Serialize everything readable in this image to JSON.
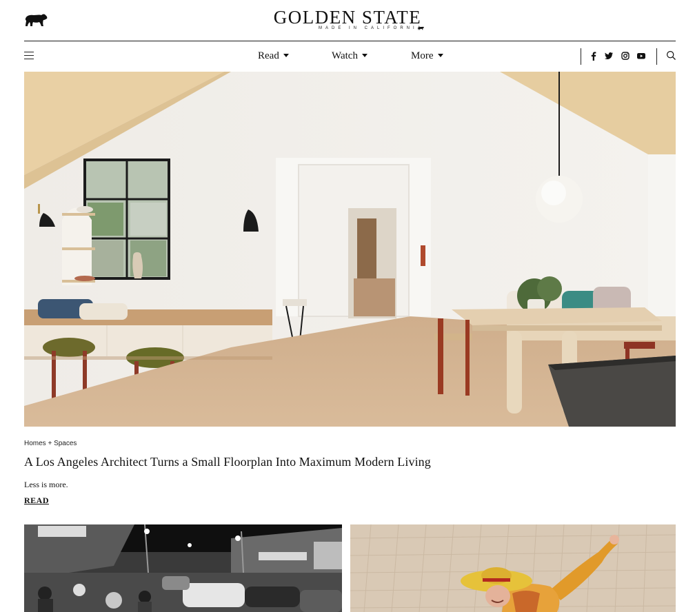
{
  "header": {
    "brand_title": "GOLDEN STATE",
    "brand_subtitle": "MADE IN CALIFORNIA",
    "logo_icon": "bear-icon"
  },
  "nav": {
    "menu_icon": "hamburger-menu-icon",
    "items": [
      {
        "label": "Read",
        "has_dropdown": true
      },
      {
        "label": "Watch",
        "has_dropdown": true
      },
      {
        "label": "More",
        "has_dropdown": true
      }
    ],
    "social_icons": [
      "facebook-icon",
      "twitter-icon",
      "instagram-icon",
      "youtube-icon"
    ],
    "search_icon": "search-icon"
  },
  "feature": {
    "category": "Homes + Spaces",
    "headline": "A Los Angeles Architect Turns a Small Floorplan Into Maximum Modern Living",
    "dek": "Less is more.",
    "cta": "READ"
  },
  "cards": [
    {
      "image": "vintage black-and-white street scene at night"
    },
    {
      "image": "person in yellow hat and orange outfit dancing"
    }
  ],
  "colors": {
    "text": "#111111",
    "divider": "#1a1a1a",
    "background": "#ffffff"
  }
}
